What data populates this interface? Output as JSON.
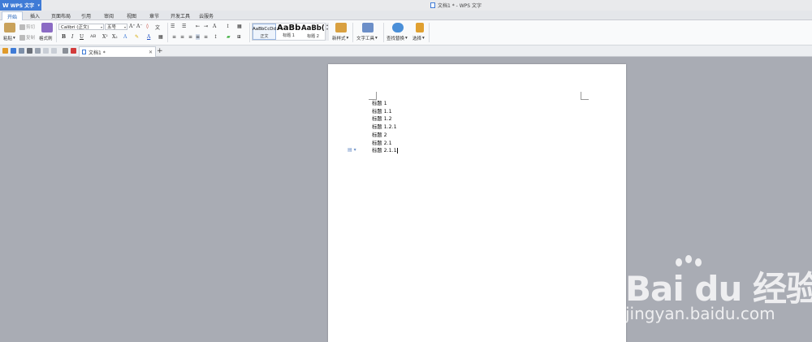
{
  "app": {
    "name": "WPS 文字",
    "window_title": "文档1 * - WPS 文字"
  },
  "menu": {
    "tabs": [
      {
        "label": "开始",
        "active": true
      },
      {
        "label": "插入"
      },
      {
        "label": "页面布局"
      },
      {
        "label": "引用"
      },
      {
        "label": "审阅"
      },
      {
        "label": "视图"
      },
      {
        "label": "章节"
      },
      {
        "label": "开发工具"
      },
      {
        "label": "云服务"
      }
    ]
  },
  "ribbon": {
    "paste": "粘贴",
    "cut": "剪切",
    "copy": "复制",
    "format_painter": "格式刷",
    "font_name": "Calibri (正文)",
    "font_size": "五号",
    "styles": {
      "normal_preview": "AaBbCcDd",
      "normal_label": "正文",
      "h1_preview": "AaBb",
      "h1_label": "标题 1",
      "h2_preview": "AaBb(",
      "h2_label": "标题 2"
    },
    "new_style": "新样式",
    "text_tools": "文字工具",
    "find_replace": "查找替换",
    "select": "选择"
  },
  "document_tab": {
    "label": "文档1 *"
  },
  "document": {
    "lines": [
      "标题 1",
      "标题 1.1",
      "标题 1.2",
      "标题 1.2.1",
      "标题 2",
      "标题 2.1",
      "标题 2.1.1"
    ]
  },
  "watermark": {
    "main": "Bai du 经验",
    "sub": "jingyan.baidu.com"
  },
  "colors": {
    "app_blue": "#3f7bd6",
    "canvas_gray": "#a9acb4"
  }
}
